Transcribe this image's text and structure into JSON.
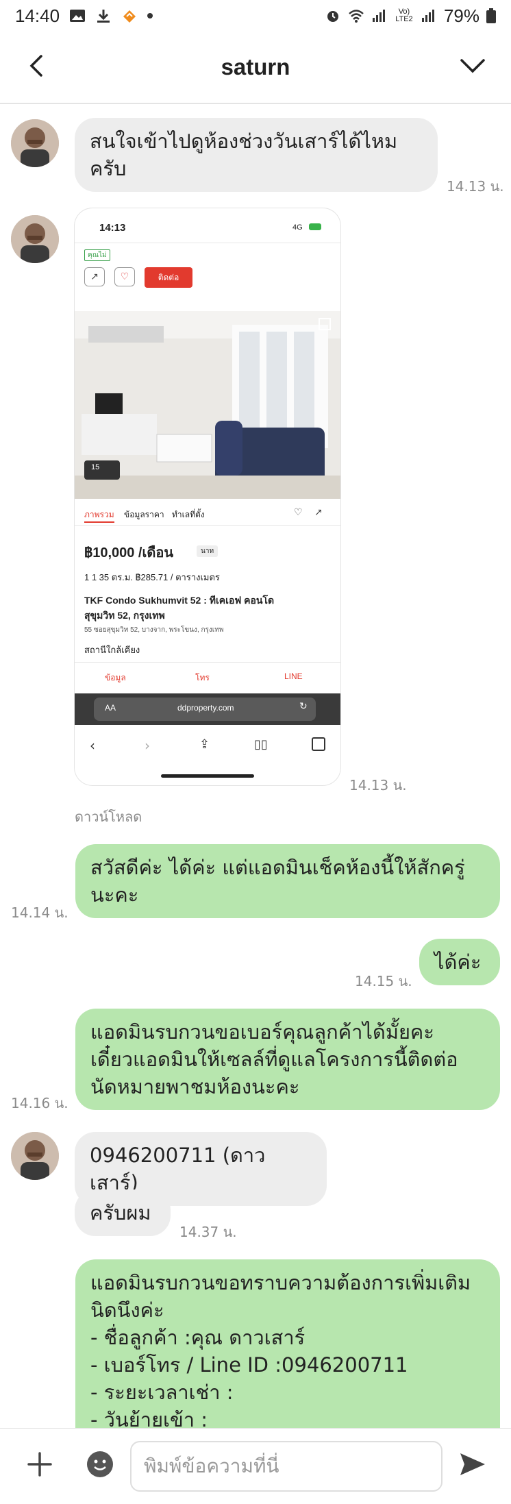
{
  "status_bar": {
    "time": "14:40",
    "battery": "79%",
    "network": "Vo) LTE2"
  },
  "header": {
    "title": "saturn"
  },
  "messages": [
    {
      "from": "in",
      "text_lines": [
        "สนใจเข้าไปดูห้องช่วงวันเสาร์ได้ไหม",
        "ครับ"
      ],
      "time": "14.13 น."
    },
    {
      "from": "in",
      "type": "image",
      "time": "14.13 น.",
      "download_label": "ดาวน์โหลด"
    },
    {
      "from": "out",
      "text_lines": [
        "สวัสดีค่ะ ได้ค่ะ แต่แอดมินเช็คห้องนี้ให้สักครู่",
        "นะคะ"
      ],
      "time": "14.14 น."
    },
    {
      "from": "out",
      "text_lines": [
        "ได้ค่ะ"
      ],
      "time": "14.15 น."
    },
    {
      "from": "out",
      "text_lines": [
        "แอดมินรบกวนขอเบอร์คุณลูกค้าได้มั้ยคะ",
        "เดี๋ยวแอดมินให้เซลล์ที่ดูแลโครงการนี้ติดต่อ",
        "นัดหมายพาชมห้องนะคะ"
      ],
      "time": "14.16 น."
    },
    {
      "from": "in",
      "text_lines": [
        "0946200711 (ดาวเสาร์)"
      ]
    },
    {
      "from": "in",
      "text_lines": [
        "ครับผม"
      ],
      "time": "14.37 น."
    },
    {
      "from": "out",
      "text_lines": [
        "แอดมินรบกวนขอทราบความต้องการเพิ่มเติม",
        "นิดนึงค่ะ",
        "- ชื่อลูกค้า :คุณ ดาวเสาร์",
        "- เบอร์โทร / Line ID :0946200711",
        "- ระยะเวลาเช่า :",
        "- วันย้ายเข้า :"
      ]
    }
  ],
  "screenshot": {
    "time": "14:13",
    "network": "4G",
    "tag": "คุณไม่",
    "contact_btn": "ติดต่อ",
    "photo_count": "15",
    "tabs": [
      "ภาพรวม",
      "ข้อมูลราคา",
      "ทำเลที่ตั้ง"
    ],
    "price": "฿10,000 /เดือน",
    "price_badge": "นาท",
    "specs": "1  1  35 ตร.ม.  ฿285.71 / ตารางเมตร",
    "name_line1": "TKF Condo Sukhumvit 52 : ทีเคเอฟ คอนโด",
    "name_line2": "สุขุมวิท 52, กรุงเทพ",
    "address": "55 ซอยสุขุมวิท 52, บางจาก, พระโขนง, กรุงเทพ",
    "station": "สถานีใกล้เคียง",
    "actions": [
      "ข้อมูล",
      "โทร",
      "LINE"
    ],
    "url": "ddproperty.com",
    "aa": "AA"
  },
  "composer": {
    "placeholder": "พิมพ์ข้อความที่นี่"
  }
}
